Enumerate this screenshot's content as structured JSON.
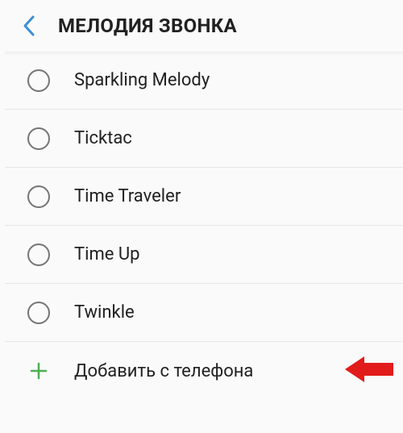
{
  "header": {
    "title": "МЕЛОДИЯ ЗВОНКА"
  },
  "ringtones": [
    {
      "label": "Sparkling Melody"
    },
    {
      "label": "Ticktac"
    },
    {
      "label": "Time Traveler"
    },
    {
      "label": "Time Up"
    },
    {
      "label": "Twinkle"
    }
  ],
  "addFromPhone": {
    "label": "Добавить с телефона"
  },
  "colors": {
    "accent": "#3a8fd6",
    "addIcon": "#4caf50",
    "arrow": "#e21b1b"
  }
}
